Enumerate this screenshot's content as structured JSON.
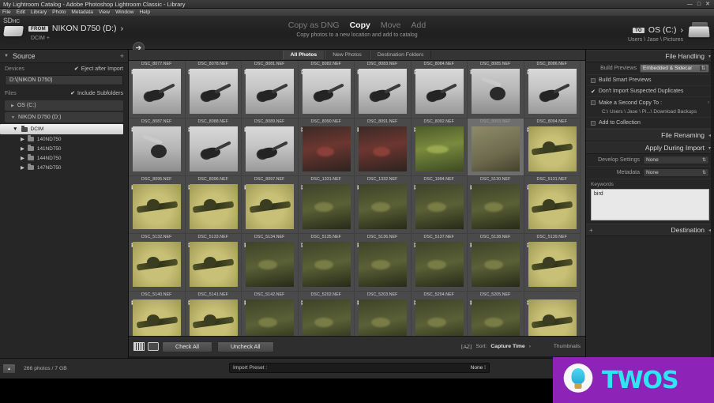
{
  "window": {
    "title": "My Lightroom Catalog - Adobe Photoshop Lightroom Classic - Library",
    "minimize": "—",
    "maximize": "□",
    "close": "✕"
  },
  "menu": {
    "items": [
      "File",
      "Edit",
      "Library",
      "Photo",
      "Metadata",
      "View",
      "Window",
      "Help"
    ]
  },
  "topbar": {
    "sd_label": "SD",
    "sd_sub": "HC",
    "from_pill": "FROM",
    "source_name": "NIKON D750  (D:)",
    "source_caret": "›",
    "source_subpath": "DCIM +",
    "arrow_icon": "arrow-right-icon",
    "modes": [
      {
        "label": "Copy as DNG",
        "active": false
      },
      {
        "label": "Copy",
        "active": true
      },
      {
        "label": "Move",
        "active": false
      },
      {
        "label": "Add",
        "active": false
      }
    ],
    "mode_description": "Copy photos to a new location and add to catalog",
    "to_pill": "TO",
    "dest_name": "OS (C:)",
    "dest_caret": "›",
    "dest_subpath": "Users \\ Jase \\ Pictures"
  },
  "source_panel": {
    "title": "Source",
    "add_icon": "+",
    "devices_label": "Devices",
    "eject_label": "Eject after Import",
    "eject_checked": true,
    "device_value": "D:\\(NIKON D750)",
    "files_label": "Files",
    "include_subfolders_label": "Include Subfolders",
    "include_subfolders_checked": true,
    "volumes": [
      {
        "label": "OS (C:)",
        "expanded": false
      },
      {
        "label": "NIKON D750  (D:)",
        "expanded": true
      }
    ],
    "tree": [
      {
        "label": "DCIM",
        "selected": true,
        "depth": 1
      },
      {
        "label": "140ND750",
        "selected": false,
        "depth": 2
      },
      {
        "label": "141ND750",
        "selected": false,
        "depth": 2
      },
      {
        "label": "144ND750",
        "selected": false,
        "depth": 2
      },
      {
        "label": "147ND750",
        "selected": false,
        "depth": 2
      }
    ]
  },
  "tabs": [
    {
      "label": "All Photos",
      "active": true
    },
    {
      "label": "New Photos",
      "active": false
    },
    {
      "label": "Destination Folders",
      "active": false
    }
  ],
  "grid": {
    "cells": [
      {
        "name": "DSC_8077.NEF",
        "style": "t-bird",
        "checked": true,
        "selected": false
      },
      {
        "name": "DSC_8078.NEF",
        "style": "t-bird",
        "checked": true,
        "selected": false
      },
      {
        "name": "DSC_8081.NEF",
        "style": "t-bird",
        "checked": true,
        "selected": false
      },
      {
        "name": "DSC_8082.NEF",
        "style": "t-bird",
        "checked": true,
        "selected": false
      },
      {
        "name": "DSC_8083.NEF",
        "style": "t-bird",
        "checked": true,
        "selected": false
      },
      {
        "name": "DSC_8084.NEF",
        "style": "t-bird",
        "checked": true,
        "selected": false
      },
      {
        "name": "DSC_8085.NEF",
        "style": "t-bird2",
        "checked": true,
        "selected": false
      },
      {
        "name": "DSC_8086.NEF",
        "style": "t-bird",
        "checked": true,
        "selected": false
      },
      {
        "name": "DSC_8087.NEF",
        "style": "t-bird2",
        "checked": true,
        "selected": false
      },
      {
        "name": "DSC_8088.NEF",
        "style": "t-bird",
        "checked": true,
        "selected": false
      },
      {
        "name": "DSC_8089.NEF",
        "style": "t-bird",
        "checked": true,
        "selected": false
      },
      {
        "name": "DSC_8090.NEF",
        "style": "t-red",
        "checked": true,
        "selected": false
      },
      {
        "name": "DSC_8091.NEF",
        "style": "t-red",
        "checked": true,
        "selected": false
      },
      {
        "name": "DSC_8092.NEF",
        "style": "t-green",
        "checked": true,
        "selected": false
      },
      {
        "name": "DSC_8093.NEF",
        "style": "t-blur",
        "checked": false,
        "selected": true
      },
      {
        "name": "DSC_8094.NEF",
        "style": "t-olive",
        "checked": true,
        "selected": false
      },
      {
        "name": "DSC_8095.NEF",
        "style": "t-olive",
        "checked": true,
        "selected": false
      },
      {
        "name": "DSC_8096.NEF",
        "style": "t-olive",
        "checked": true,
        "selected": false
      },
      {
        "name": "DSC_8097.NEF",
        "style": "t-olive",
        "checked": true,
        "selected": false
      },
      {
        "name": "DSC_1331.NEF",
        "style": "t-dark",
        "checked": true,
        "selected": false
      },
      {
        "name": "DSC_1332.NEF",
        "style": "t-dark",
        "checked": true,
        "selected": false
      },
      {
        "name": "DSC_1994.NEF",
        "style": "t-dark",
        "checked": true,
        "selected": false
      },
      {
        "name": "DSC_5130.NEF",
        "style": "t-dark",
        "checked": true,
        "selected": false
      },
      {
        "name": "DSC_5131.NEF",
        "style": "t-olive",
        "checked": true,
        "selected": false
      },
      {
        "name": "DSC_5132.NEF",
        "style": "t-olive",
        "checked": true,
        "selected": false
      },
      {
        "name": "DSC_5133.NEF",
        "style": "t-olive",
        "checked": true,
        "selected": false
      },
      {
        "name": "DSC_5134.NEF",
        "style": "t-dark",
        "checked": true,
        "selected": false
      },
      {
        "name": "DSC_5135.NEF",
        "style": "t-dark",
        "checked": true,
        "selected": false
      },
      {
        "name": "DSC_5136.NEF",
        "style": "t-dark",
        "checked": true,
        "selected": false
      },
      {
        "name": "DSC_5137.NEF",
        "style": "t-dark",
        "checked": true,
        "selected": false
      },
      {
        "name": "DSC_5138.NEF",
        "style": "t-dark",
        "checked": true,
        "selected": false
      },
      {
        "name": "DSC_5139.NEF",
        "style": "t-olive",
        "checked": true,
        "selected": false
      },
      {
        "name": "DSC_5140.NEF",
        "style": "t-olive",
        "checked": true,
        "selected": false
      },
      {
        "name": "DSC_5141.NEF",
        "style": "t-olive",
        "checked": true,
        "selected": false
      },
      {
        "name": "DSC_5142.NEF",
        "style": "t-dark",
        "checked": true,
        "selected": false
      },
      {
        "name": "DSC_5202.NEF",
        "style": "t-dark",
        "checked": true,
        "selected": false
      },
      {
        "name": "DSC_5203.NEF",
        "style": "t-dark",
        "checked": true,
        "selected": false
      },
      {
        "name": "DSC_5204.NEF",
        "style": "t-dark",
        "checked": true,
        "selected": false
      },
      {
        "name": "DSC_5205.NEF",
        "style": "t-dark",
        "checked": true,
        "selected": false
      },
      {
        "name": "",
        "style": "t-olive",
        "checked": true,
        "selected": false
      },
      {
        "name": "",
        "style": "t-olive",
        "checked": true,
        "selected": false
      },
      {
        "name": "",
        "style": "t-olive",
        "checked": true,
        "selected": false
      },
      {
        "name": "",
        "style": "t-dark",
        "checked": true,
        "selected": false
      },
      {
        "name": "",
        "style": "t-dark",
        "checked": true,
        "selected": false
      },
      {
        "name": "",
        "style": "t-dark",
        "checked": true,
        "selected": false
      },
      {
        "name": "",
        "style": "t-dark",
        "checked": true,
        "selected": false
      },
      {
        "name": "",
        "style": "t-dark",
        "checked": true,
        "selected": false
      }
    ]
  },
  "toolbar": {
    "grid_view_icon": "grid-view-icon",
    "loupe_view_icon": "loupe-view-icon",
    "check_all": "Check All",
    "uncheck_all": "Uncheck All",
    "sort_icon": "sort-az-icon",
    "sort_label": "Sort:",
    "sort_value": "Capture Time",
    "sort_caret": "›",
    "thumbnails_label": "Thumbnails"
  },
  "right_panel": {
    "file_handling": {
      "title": "File Handling",
      "caret": "▾",
      "build_previews_label": "Build Previews",
      "build_previews_value": "Embedded & Sidecar",
      "build_smart_previews": "Build Smart Previews",
      "build_smart_previews_checked": false,
      "dont_import_duplicates": "Don't Import Suspected Duplicates",
      "dont_import_duplicates_checked": true,
      "second_copy_label": "Make a Second Copy To :",
      "second_copy_checked": false,
      "second_copy_path": "C:\\ Users \\ Jase \\ Pi...\\ Download Backups",
      "add_to_collection": "Add to Collection",
      "add_to_collection_checked": false
    },
    "file_renaming": {
      "title": "File Renaming",
      "caret": "◂"
    },
    "apply_during_import": {
      "title": "Apply During Import",
      "caret": "▾",
      "develop_settings_label": "Develop Settings",
      "develop_settings_value": "None",
      "metadata_label": "Metadata",
      "metadata_value": "None",
      "keywords_label": "Keywords",
      "keywords_value": "bird"
    },
    "destination": {
      "title": "Destination",
      "caret": "◂",
      "plus": "+"
    }
  },
  "statusbar": {
    "collapse_icon": "▴",
    "photo_count": "266 photos / 7 GB",
    "import_preset_label": "Import Preset :",
    "import_preset_value": "None ⁞"
  },
  "watermark": {
    "text": "TWOS",
    "badge_icon": "lightbulb-badge-icon"
  },
  "colors": {
    "panel_bg": "#262626",
    "grid_bg": "#4a4a4a",
    "accent": "#8e23b8",
    "watermark_text": "#2ee6f2"
  }
}
